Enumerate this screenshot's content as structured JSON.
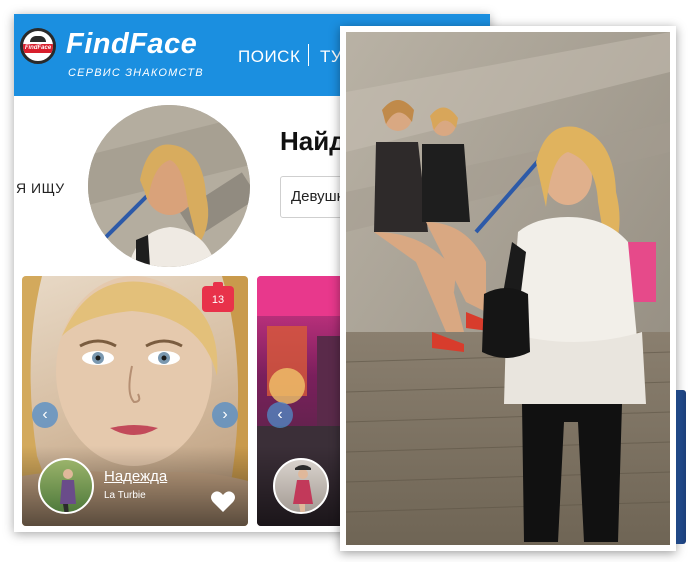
{
  "header": {
    "logo_text": "FindFace",
    "brand_name": "FindFace",
    "brand_subtitle": "СЕРВИС ЗНАКОМСТВ",
    "nav_search": "ПОИСК",
    "nav_next": "ТУ"
  },
  "search": {
    "seek_label": "Я ИЩУ",
    "heading": "Найд",
    "gender_value": "Девушку"
  },
  "cards": [
    {
      "name": "Надежда",
      "location": "La Turbie",
      "photo_count": "13"
    },
    {
      "name": "",
      "location": ""
    }
  ],
  "colors": {
    "header_bg": "#1b8fe0",
    "badge_red": "#e8324a",
    "arrow_blue": "#508cc8"
  },
  "icons": [
    "camera-icon",
    "chevron-left-icon",
    "chevron-right-icon",
    "heart-icon"
  ]
}
